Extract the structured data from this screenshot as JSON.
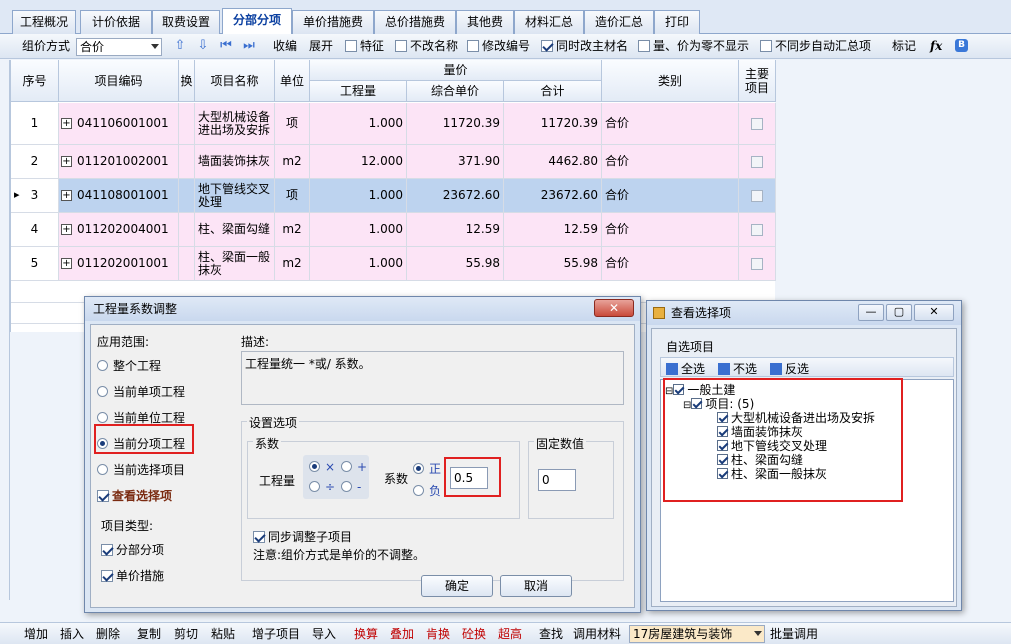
{
  "tabs": [
    "工程概况",
    "计价依据",
    "取费设置",
    "分部分项",
    "单价措施费",
    "总价措施费",
    "其他费",
    "材料汇总",
    "造价汇总",
    "打印"
  ],
  "toolbar": {
    "pricing_mode_label": "组价方式",
    "pricing_mode_value": "合价",
    "collapse": "收编",
    "expand": "展开",
    "options": [
      {
        "label": "特征",
        "checked": false
      },
      {
        "label": "不改名称",
        "checked": false
      },
      {
        "label": "修改编号",
        "checked": false
      },
      {
        "label": "同时改主材名",
        "checked": true
      },
      {
        "label": "量、价为零不显示",
        "checked": false
      },
      {
        "label": "不同步自动汇总项",
        "checked": false
      }
    ],
    "mark": "标记",
    "fx": "fx"
  },
  "grid": {
    "headers": {
      "seq": "序号",
      "code": "项目编码",
      "swap": "换",
      "name": "项目名称",
      "unit": "单位",
      "price_group": "量价",
      "qty": "工程量",
      "unit_price": "综合单价",
      "total": "合计",
      "category": "类别",
      "main": "主要项目"
    },
    "rows": [
      {
        "seq": "1",
        "code": "041106001001",
        "name": "大型机械设备进出场及安拆",
        "unit": "项",
        "qty": "1.000",
        "unit_price": "11720.39",
        "total": "11720.39",
        "category": "合价"
      },
      {
        "seq": "2",
        "code": "011201002001",
        "name": "墙面装饰抹灰",
        "unit": "m2",
        "qty": "12.000",
        "unit_price": "371.90",
        "total": "4462.80",
        "category": "合价"
      },
      {
        "seq": "3",
        "code": "041108001001",
        "name": "地下管线交叉处理",
        "unit": "项",
        "qty": "1.000",
        "unit_price": "23672.60",
        "total": "23672.60",
        "category": "合价"
      },
      {
        "seq": "4",
        "code": "011202004001",
        "name": "柱、梁面勾缝",
        "unit": "m2",
        "qty": "1.000",
        "unit_price": "12.59",
        "total": "12.59",
        "category": "合价"
      },
      {
        "seq": "5",
        "code": "011202001001",
        "name": "柱、梁面一般抹灰",
        "unit": "m2",
        "qty": "1.000",
        "unit_price": "55.98",
        "total": "55.98",
        "category": "合价"
      }
    ]
  },
  "dialog1": {
    "title": "工程量系数调整",
    "scope_label": "应用范围:",
    "scopes": [
      "整个工程",
      "当前单项工程",
      "当前单位工程",
      "当前分项工程",
      "当前选择项目"
    ],
    "scope_selected": 3,
    "view_selection": "查看选择项",
    "item_type_label": "项目类型:",
    "item_types": [
      "分部分项",
      "单价措施"
    ],
    "desc_label": "描述:",
    "desc_text": "工程量统一 *或/ 系数。",
    "settings_label": "设置选项",
    "coef_group": "系数",
    "qty_label": "工程量",
    "ops": [
      "×",
      "+",
      "÷",
      "-"
    ],
    "coef_label": "系数",
    "positive": "正",
    "negative": "负",
    "coef_value": "0.5",
    "fixed_label": "固定数值",
    "fixed_value": "0",
    "sync_children": "同步调整子项目",
    "note": "注意:组价方式是单价的不调整。",
    "ok": "确定",
    "cancel": "取消"
  },
  "dialog2": {
    "title": "查看选择项",
    "custom_items": "自选项目",
    "select_all": "全选",
    "select_none": "不选",
    "invert": "反选",
    "tree_root": "一般土建",
    "tree_group": "项目: (5)",
    "tree_items": [
      "大型机械设备进出场及安拆",
      "墙面装饰抹灰",
      "地下管线交叉处理",
      "柱、梁面勾缝",
      "柱、梁面一般抹灰"
    ]
  },
  "bottombar": {
    "buttons": [
      {
        "label": "增加",
        "red": false
      },
      {
        "label": "插入",
        "red": false
      },
      {
        "label": "删除",
        "red": false
      },
      {
        "label": "复制",
        "red": false
      },
      {
        "label": "剪切",
        "red": false
      },
      {
        "label": "粘贴",
        "red": false
      },
      {
        "label": "增子项目",
        "red": false
      },
      {
        "label": "导入",
        "red": false
      },
      {
        "label": "换算",
        "red": true
      },
      {
        "label": "叠加",
        "red": true
      },
      {
        "label": "肯换",
        "red": true
      },
      {
        "label": "砼换",
        "red": true
      },
      {
        "label": "超高",
        "red": true
      },
      {
        "label": "查找",
        "red": false
      },
      {
        "label": "调用材料",
        "red": false
      }
    ],
    "combo_value": "17房屋建筑与装饰",
    "batch": "批量调用"
  },
  "colors": {
    "accent": "#0a3fa0",
    "pink_row": "#fce4f6",
    "selected_row": "#bdd3ef",
    "highlight_box": "#e02020"
  }
}
